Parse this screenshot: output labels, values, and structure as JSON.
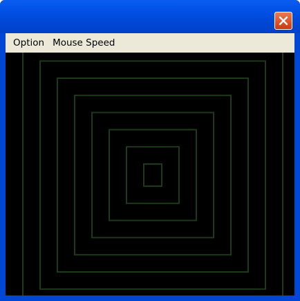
{
  "window": {
    "close_icon": "close-x-icon"
  },
  "menu": {
    "items": [
      {
        "label": "Option"
      },
      {
        "label": "Mouse Speed"
      }
    ]
  },
  "canvas": {
    "background_color": "#000000",
    "line_color": "#1d3a1a",
    "squares_count": 8,
    "pattern": "concentric-squares"
  }
}
